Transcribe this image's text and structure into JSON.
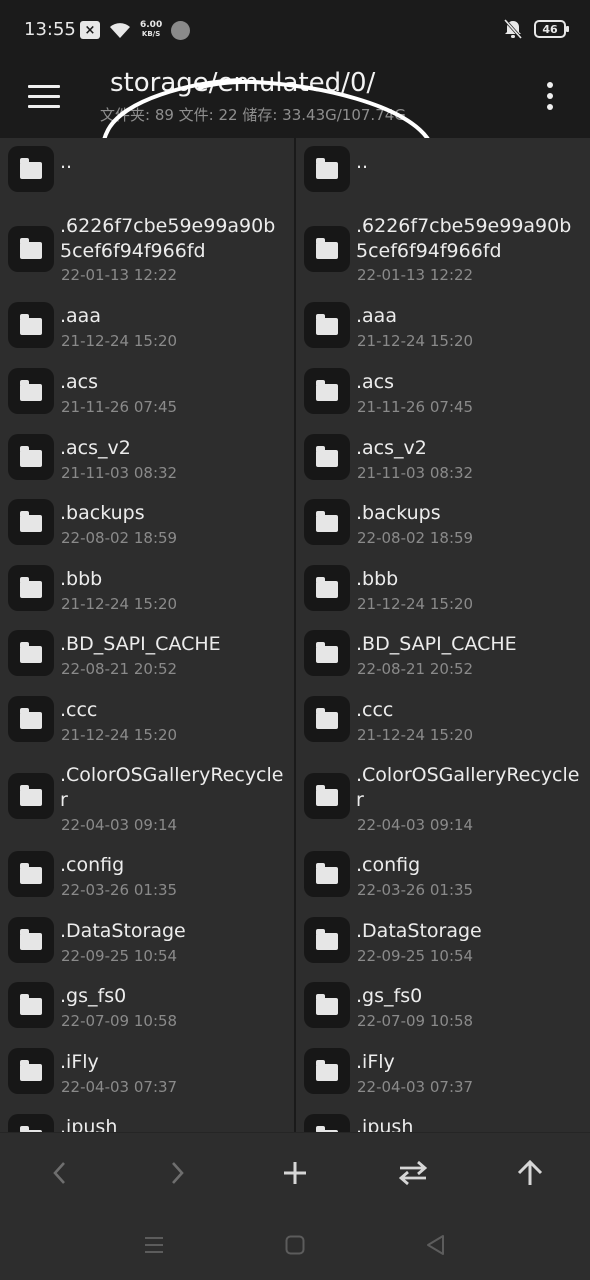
{
  "status_bar": {
    "time": "13:55",
    "net_speed_value": "6.00",
    "net_speed_unit": "KB/S",
    "battery": "46"
  },
  "app_bar": {
    "path": "storage/emulated/0/",
    "stats": "文件夹: 89  文件: 22  储存: 33.43G/107.74G"
  },
  "files": [
    {
      "name": "..",
      "date": ""
    },
    {
      "name": ".6226f7cbe59e99a90b5cef6f94f966fd",
      "date": "22-01-13 12:22"
    },
    {
      "name": ".aaa",
      "date": "21-12-24 15:20"
    },
    {
      "name": ".acs",
      "date": "21-11-26 07:45"
    },
    {
      "name": ".acs_v2",
      "date": "21-11-03 08:32"
    },
    {
      "name": ".backups",
      "date": "22-08-02 18:59"
    },
    {
      "name": ".bbb",
      "date": "21-12-24 15:20"
    },
    {
      "name": ".BD_SAPI_CACHE",
      "date": "22-08-21 20:52"
    },
    {
      "name": ".ccc",
      "date": "21-12-24 15:20"
    },
    {
      "name": ".ColorOSGalleryRecycler",
      "date": "22-04-03 09:14"
    },
    {
      "name": ".config",
      "date": "22-03-26 01:35"
    },
    {
      "name": ".DataStorage",
      "date": "22-09-25 10:54"
    },
    {
      "name": ".gs_fs0",
      "date": "22-07-09 10:58"
    },
    {
      "name": ".iFly",
      "date": "22-04-03 07:37"
    },
    {
      "name": ".ipush",
      "date": ""
    }
  ],
  "icons": {
    "menu": "hamburger-menu-icon",
    "more": "more-vert-icon",
    "folder": "folder-icon",
    "back": "chevron-left-icon",
    "forward": "chevron-right-icon",
    "add": "plus-icon",
    "swap": "swap-icon",
    "up": "arrow-up-icon"
  },
  "colors": {
    "app_bar_bg": "#1b1b1b",
    "pane_bg": "#2d2d2d",
    "icon_tile_bg": "#171717",
    "accent_text": "#ececec",
    "muted_text": "#8a8a8a"
  }
}
